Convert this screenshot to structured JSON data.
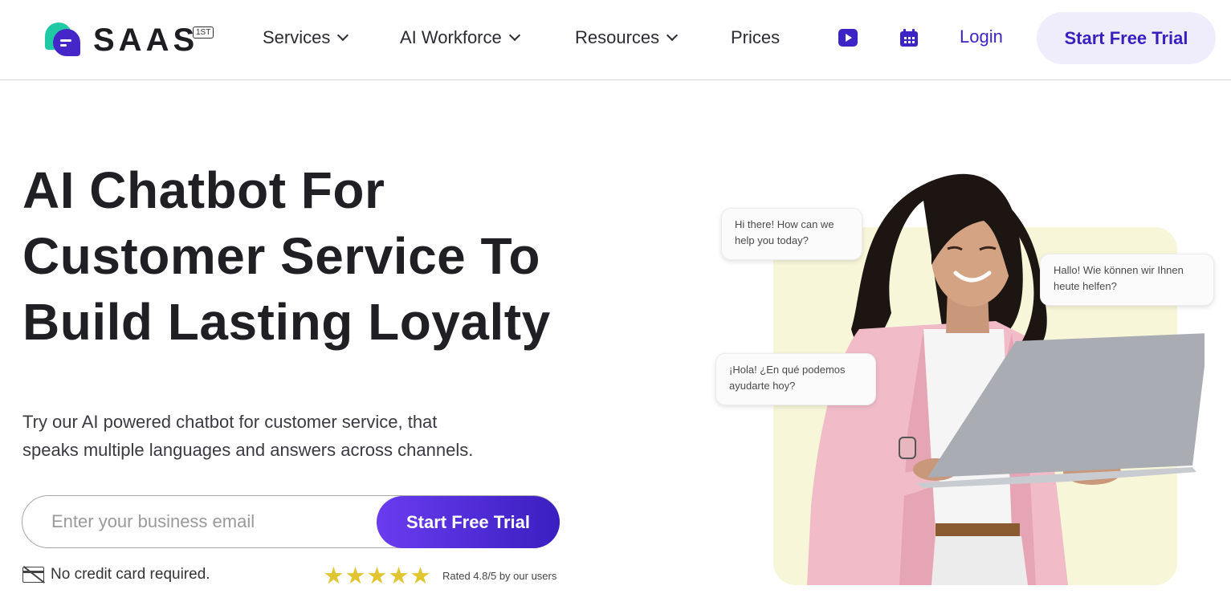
{
  "brand": {
    "name": "SAAS",
    "badge": "1ST"
  },
  "nav": {
    "items": [
      {
        "label": "Services",
        "dropdown": true
      },
      {
        "label": "AI Workforce",
        "dropdown": true
      },
      {
        "label": "Resources",
        "dropdown": true
      },
      {
        "label": "Prices",
        "dropdown": false
      }
    ],
    "icons": [
      "youtube-icon",
      "calendar-icon"
    ],
    "login_label": "Login",
    "cta_label": "Start Free Trial"
  },
  "hero": {
    "headline_lines": [
      "AI Chatbot For",
      "Customer Service To",
      "Build Lasting Loyalty"
    ],
    "subtext_lines": [
      "Try our AI powered chatbot for customer service, that",
      "speaks multiple languages and answers across channels."
    ],
    "email_placeholder": "Enter your business email",
    "cta_label": "Start Free Trial",
    "no_card_text": "No credit card required.",
    "rating": {
      "stars": 5,
      "text": "Rated 4.8/5 by our users"
    }
  },
  "chat_bubbles": [
    "Hi there! How can we help you today?",
    "Hallo! Wie können wir Ihnen heute helfen?",
    "¡Hola! ¿En qué podemos ayudarte hoy?"
  ],
  "colors": {
    "brand_purple": "#3d24c4",
    "brand_teal": "#1fc9a4",
    "cta_light_bg": "#efedfb",
    "panel_yellow": "#f8f6d9",
    "star_gold": "#e0c530"
  }
}
